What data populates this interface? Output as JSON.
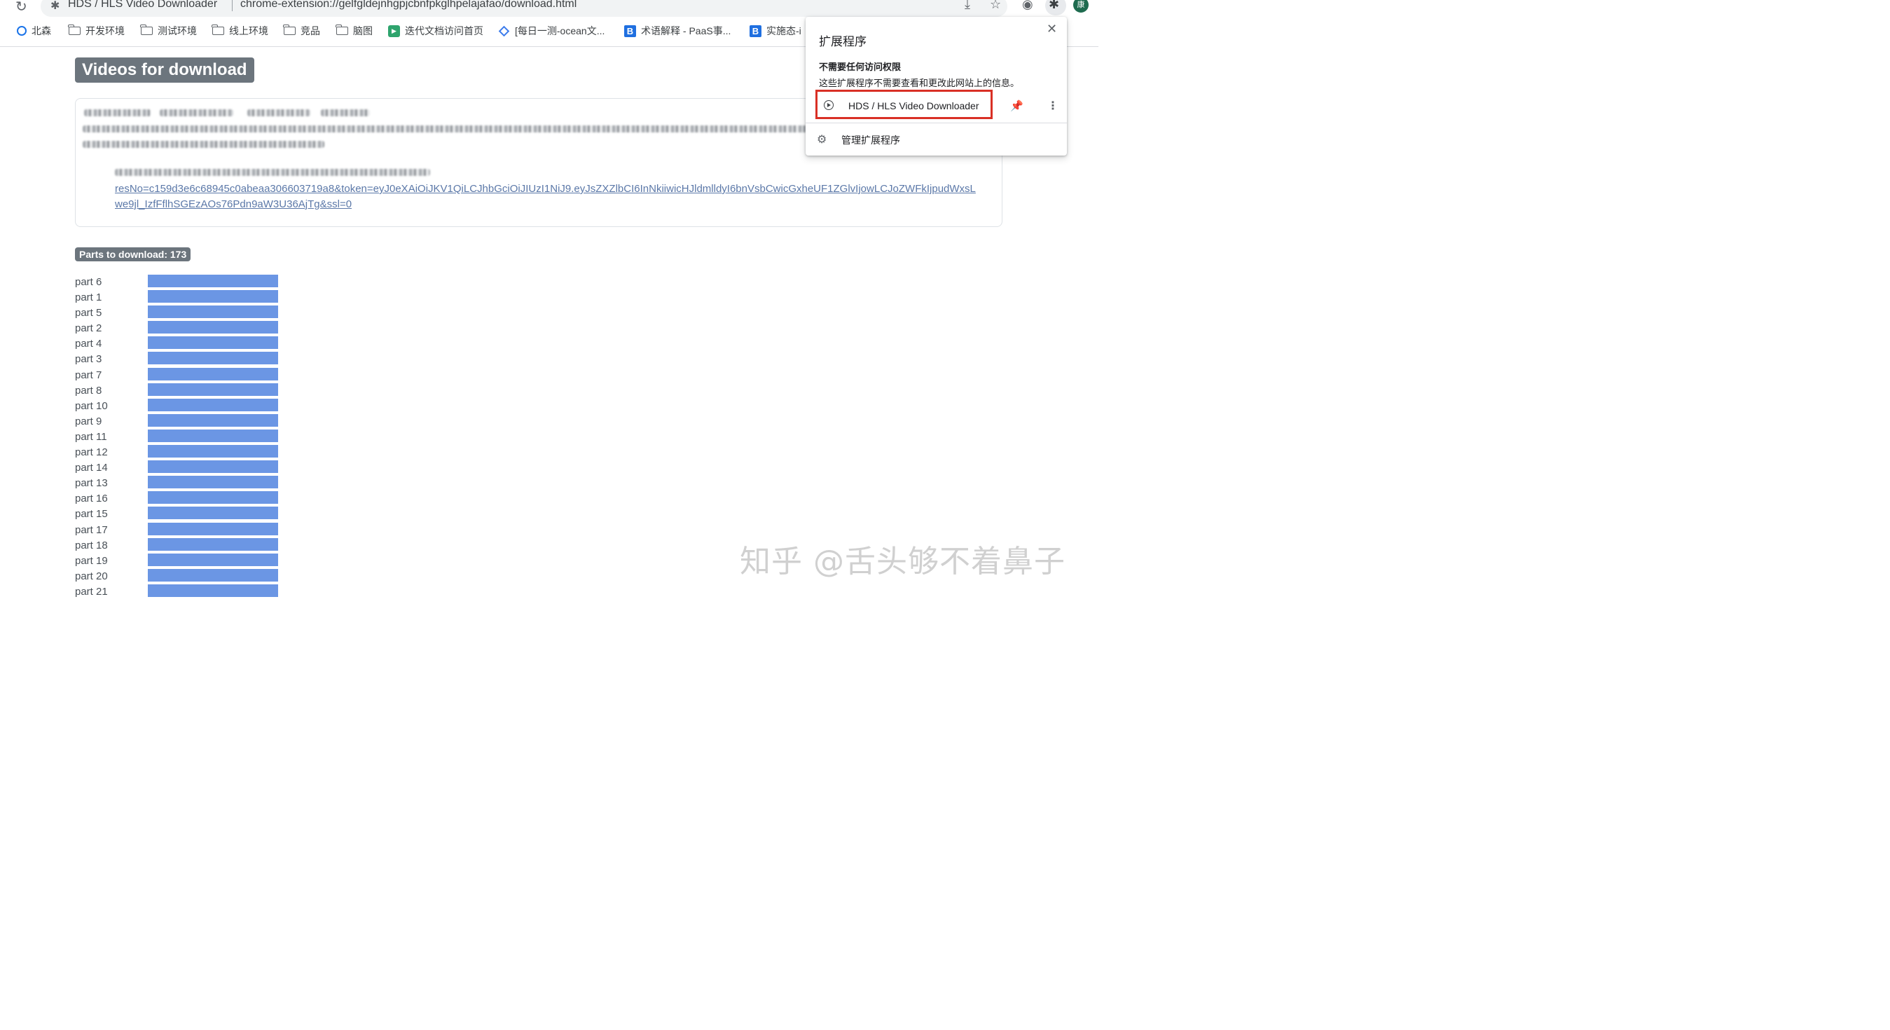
{
  "browser": {
    "tab_title": "HDS / HLS Video Downloader",
    "url": "chrome-extension://gelfgldejnhgpjcbnfpkglhpelajafao/download.html",
    "profile_initial": "康",
    "icons": [
      "reload-icon",
      "extension-icon",
      "download-icon",
      "star-icon",
      "play-extension-icon",
      "puzzle-icon"
    ]
  },
  "bookmarks": {
    "items": [
      {
        "label": "北森",
        "icon": "globe-icon"
      },
      {
        "label": "开发环境",
        "icon": "folder-icon"
      },
      {
        "label": "测试环境",
        "icon": "folder-icon"
      },
      {
        "label": "线上环境",
        "icon": "folder-icon"
      },
      {
        "label": "竞品",
        "icon": "folder-icon"
      },
      {
        "label": "脑图",
        "icon": "folder-icon"
      },
      {
        "label": "迭代文档访问首页",
        "icon": "green-bookmark-icon"
      },
      {
        "label": "[每日一测-ocean文...",
        "icon": "diamond-icon"
      },
      {
        "label": "术语解释 - PaaS事...",
        "icon": "b-icon"
      },
      {
        "label": "实施态-i",
        "icon": "b-icon"
      }
    ]
  },
  "page": {
    "heading": "Videos for download",
    "url_line_1": "resNo=c159d3e6c68945c0abeaa306603719a8&token=eyJ0eXAiOiJKV1QiLCJhbGciOiJIUzI1NiJ9.eyJsZXZlbCI6InNkiiwicHJldmlldyI6bnVsbCwicGxheUF1ZGlvIjowLCJoZWFkIjpudWxsL",
    "url_line_2": "we9jl_IzfFflhSGEzAOs76Pdn9aW3U36AjTg&ssl=0",
    "parts_badge": "Parts to download: 173",
    "progress_color": "#6b96e4",
    "parts": [
      {
        "label": "part 6",
        "progress": 1.0
      },
      {
        "label": "part 1",
        "progress": 1.0
      },
      {
        "label": "part 5",
        "progress": 1.0
      },
      {
        "label": "part 2",
        "progress": 1.0
      },
      {
        "label": "part 4",
        "progress": 1.0
      },
      {
        "label": "part 3",
        "progress": 1.0
      },
      {
        "label": "part 7",
        "progress": 1.0
      },
      {
        "label": "part 8",
        "progress": 1.0
      },
      {
        "label": "part 10",
        "progress": 1.0
      },
      {
        "label": "part 9",
        "progress": 1.0
      },
      {
        "label": "part 11",
        "progress": 1.0
      },
      {
        "label": "part 12",
        "progress": 1.0
      },
      {
        "label": "part 14",
        "progress": 1.0
      },
      {
        "label": "part 13",
        "progress": 1.0
      },
      {
        "label": "part 16",
        "progress": 1.0
      },
      {
        "label": "part 15",
        "progress": 1.0
      },
      {
        "label": "part 17",
        "progress": 1.0
      },
      {
        "label": "part 18",
        "progress": 1.0
      },
      {
        "label": "part 19",
        "progress": 1.0
      },
      {
        "label": "part 20",
        "progress": 1.0
      },
      {
        "label": "part 21",
        "progress": 1.0
      }
    ]
  },
  "popup": {
    "title": "扩展程序",
    "section_title": "不需要任何访问权限",
    "section_desc": "这些扩展程序不需要查看和更改此网站上的信息。",
    "extension_name": "HDS / HLS Video Downloader",
    "manage_label": "管理扩展程序",
    "highlight_color": "#d93025",
    "pin_color": "#1a73e8"
  },
  "watermark": "知乎 @舌头够不着鼻子"
}
